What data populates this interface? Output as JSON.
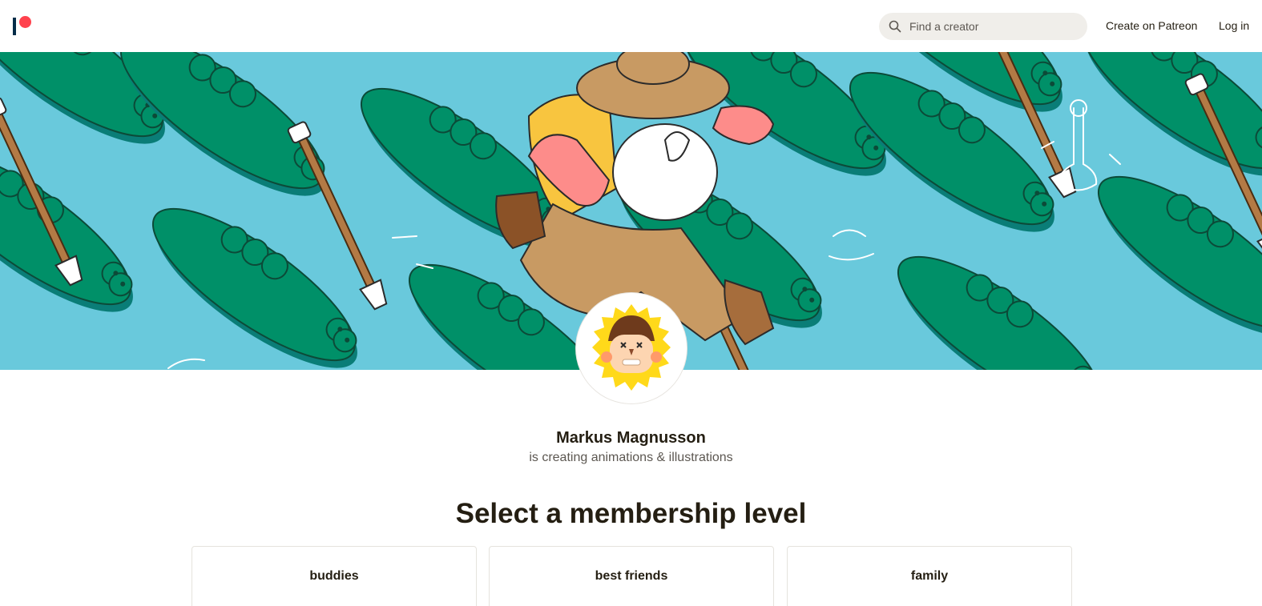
{
  "nav": {
    "search_placeholder": "Find a creator",
    "create_label": "Create on Patreon",
    "login_label": "Log in"
  },
  "creator": {
    "name": "Markus Magnusson",
    "description": "is creating animations & illustrations"
  },
  "membership": {
    "title": "Select a membership level",
    "tiers": [
      {
        "name": "buddies"
      },
      {
        "name": "best friends"
      },
      {
        "name": "family"
      }
    ]
  },
  "colors": {
    "brand_coral": "#ff424d",
    "brand_navy": "#052d49",
    "banner_water": "#69c9dc",
    "banner_croc": "#009068",
    "text_primary": "#241e12",
    "text_secondary": "#5c5751"
  }
}
